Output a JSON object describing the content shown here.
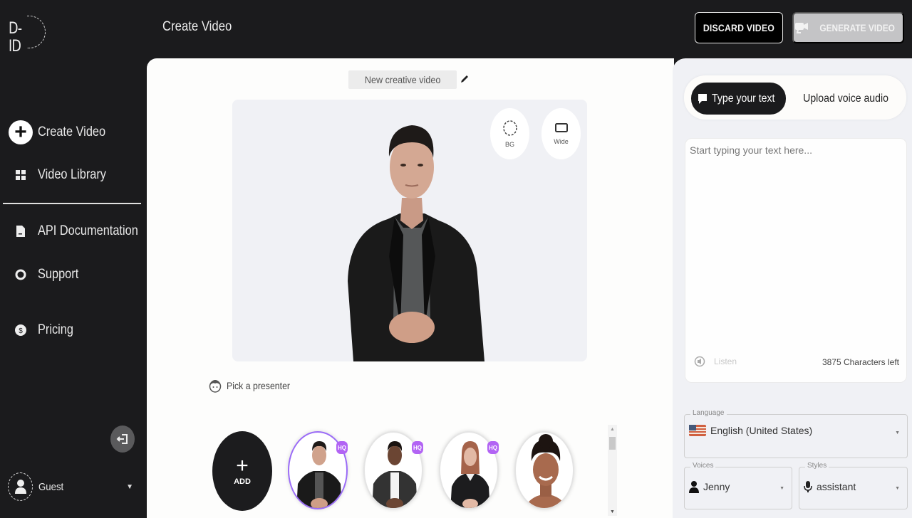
{
  "app": {
    "logo": "D-ID",
    "title": "Create Video"
  },
  "header": {
    "discard_label": "DISCARD VIDEO",
    "generate_label": "GENERATE VIDEO"
  },
  "sidebar": {
    "items": [
      {
        "label": "Create Video",
        "icon": "plus-circle-icon"
      },
      {
        "label": "Video Library",
        "icon": "grid-icon"
      },
      {
        "label": "API Documentation",
        "icon": "document-icon"
      },
      {
        "label": "Support",
        "icon": "lifebuoy-icon"
      },
      {
        "label": "Pricing",
        "icon": "dollar-icon"
      }
    ],
    "user": {
      "name": "Guest"
    }
  },
  "editor": {
    "video_name": "New creative video",
    "stage_buttons": [
      {
        "label": "BG",
        "icon": "background-icon"
      },
      {
        "label": "Wide",
        "icon": "wide-frame-icon"
      }
    ],
    "pick_presenter_label": "Pick a presenter",
    "add_label": "ADD",
    "presenters": [
      {
        "name": "presenter-1",
        "hq": true,
        "selected": true
      },
      {
        "name": "presenter-2",
        "hq": true,
        "selected": false
      },
      {
        "name": "presenter-3",
        "hq": true,
        "selected": false
      },
      {
        "name": "presenter-4",
        "hq": false,
        "selected": false
      }
    ],
    "hq_badge": "HQ"
  },
  "script_panel": {
    "tab_type_label": "Type your text",
    "tab_upload_label": "Upload voice audio",
    "text_placeholder": "Start typing your text here...",
    "text_value": "",
    "listen_label": "Listen",
    "characters_left": "3875 Characters left",
    "language": {
      "legend": "Language",
      "value": "English (United States)",
      "flag": "us-flag-icon"
    },
    "voices": {
      "legend": "Voices",
      "value": "Jenny"
    },
    "styles": {
      "legend": "Styles",
      "value": "assistant"
    }
  },
  "colors": {
    "sidebar_bg": "#1b1b1d",
    "accent_hq": "#b264f4",
    "selected_ring": "#9b6cf7"
  }
}
